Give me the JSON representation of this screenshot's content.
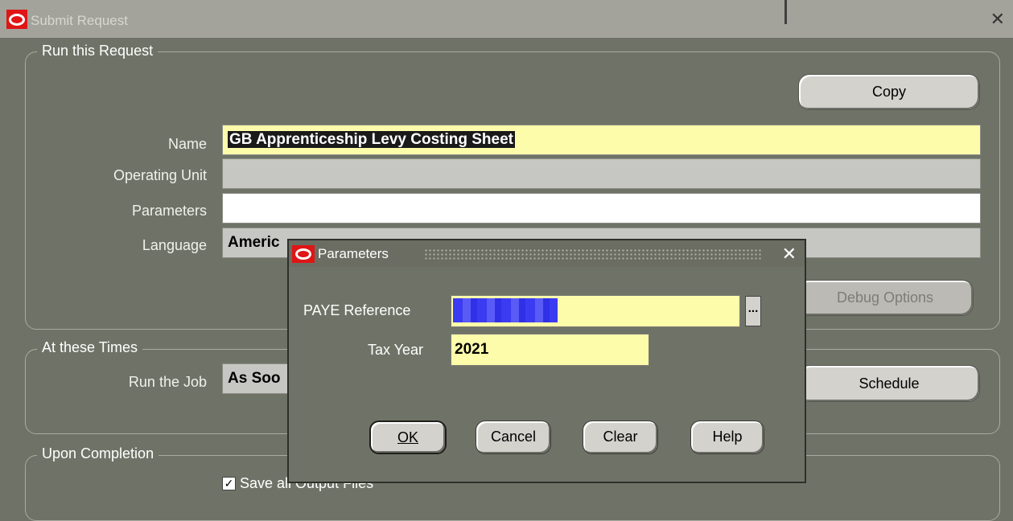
{
  "window": {
    "title": "Submit Request",
    "close_glyph": "✕"
  },
  "run_request": {
    "group_label": "Run this Request",
    "copy_button": "Copy",
    "name_label": "Name",
    "name_value": "GB Apprenticeship Levy Costing Sheet",
    "operating_unit_label": "Operating Unit",
    "operating_unit_value": "",
    "parameters_label": "Parameters",
    "parameters_value": "",
    "language_label": "Language",
    "language_value": "Americ",
    "debug_button": "Debug Options"
  },
  "times": {
    "group_label": "At these Times",
    "run_job_label": "Run the Job",
    "run_job_value": "As Soo",
    "schedule_button": "Schedule"
  },
  "completion": {
    "group_label": "Upon Completion",
    "save_output_label": "Save all Output Files",
    "save_output_checked": true
  },
  "dialog": {
    "title": "Parameters",
    "close_glyph": "✕",
    "paye_label": "PAYE Reference",
    "paye_value": "",
    "lov_glyph": "...",
    "tax_year_label": "Tax Year",
    "tax_year_value": "2021",
    "ok_button": "OK",
    "cancel_button": "Cancel",
    "clear_button": "Clear",
    "help_button": "Help"
  },
  "colors": {
    "required_field": "#fdfcab",
    "oracle_red": "#e01515"
  }
}
